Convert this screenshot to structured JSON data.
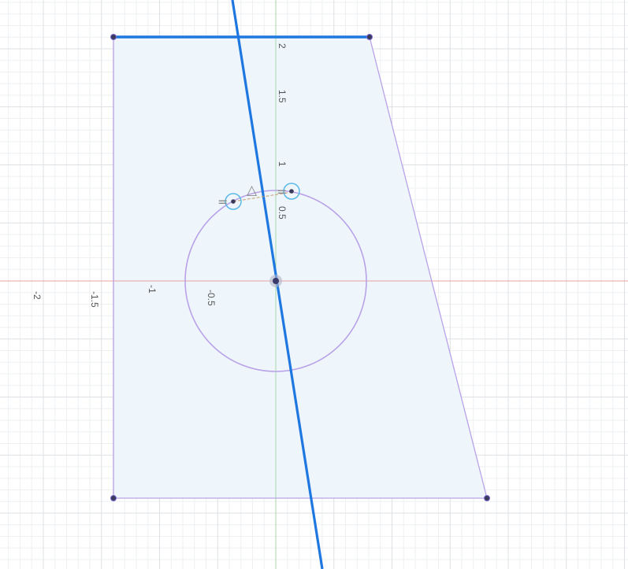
{
  "colors": {
    "background": "#ffffff",
    "grid_minor": "#eef0f2",
    "grid_major": "#dde1e5",
    "axis_x": "#e8a0a0",
    "axis_y": "#a8d8a8",
    "profile_fill": "#eef6fb",
    "sketch_line": "#b9a2e8",
    "selected_line": "#1f77e0",
    "point": "#3a3a5a",
    "constraint_circle": "#5ab8e8",
    "dim_line": "#c8a070"
  },
  "axis_labels": {
    "x": [
      "-2",
      "-1.5",
      "-1",
      "-0.5"
    ],
    "y": [
      "2",
      "1.5",
      "1",
      "0.5"
    ]
  },
  "sketch": {
    "origin_point": "origin-point",
    "circle": {
      "radius": 0.68
    },
    "polygon_vertices": [
      [
        -1.22,
        1.82
      ],
      [
        0.7,
        1.82
      ],
      [
        1.58,
        -1.63
      ],
      [
        -1.22,
        -1.63
      ]
    ],
    "construction_line": {
      "p1": [
        -0.33,
        2.15
      ],
      "p2": [
        0.35,
        -2.15
      ]
    }
  },
  "constraint_glyphs": {
    "parallel_a": "=",
    "parallel_b": "=",
    "triangle": "△"
  }
}
